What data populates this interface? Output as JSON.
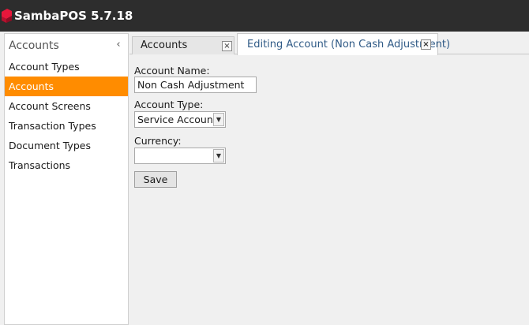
{
  "app": {
    "title": "SambaPOS 5.7.18",
    "logo_icon": "sambapos-logo-icon",
    "logo_colors": [
      "#e8173b",
      "#b5112e"
    ]
  },
  "sidebar": {
    "title": "Accounts",
    "collapse_glyph": "‹",
    "items": [
      {
        "label": "Account Types",
        "active": false
      },
      {
        "label": "Accounts",
        "active": true
      },
      {
        "label": "Account Screens",
        "active": false
      },
      {
        "label": "Transaction Types",
        "active": false
      },
      {
        "label": "Document Types",
        "active": false
      },
      {
        "label": "Transactions",
        "active": false
      }
    ],
    "accent_color": "#ff8c00"
  },
  "tabs": [
    {
      "label": "Accounts",
      "close_glyph": "×",
      "active": false
    },
    {
      "label": "Editing Account (Non Cash Adjustment)",
      "close_glyph": "×",
      "active": true
    }
  ],
  "form": {
    "account_name": {
      "label": "Account Name:",
      "value": "Non Cash Adjustment"
    },
    "account_type": {
      "label": "Account Type:",
      "value": "Service Accounts",
      "arrow_glyph": "▼"
    },
    "currency": {
      "label": "Currency:",
      "value": "",
      "arrow_glyph": "▼"
    },
    "save_label": "Save"
  }
}
